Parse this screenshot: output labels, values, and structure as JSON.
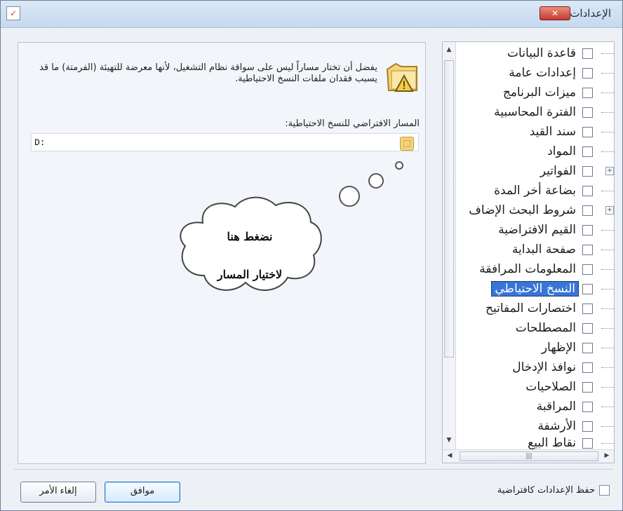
{
  "window": {
    "title": "الإعدادات",
    "title_icon": "settings-checklist-icon",
    "close_label": "✕"
  },
  "warning": {
    "icon": "warning-folder-icon",
    "text": "يفضل أن تختار مساراً ليس على سواقة نظام التشغيل، لأنها معرضة للتهيئة (الفرمتة) ما قد يسبب فقدان ملفات النسخ الاحتياطية."
  },
  "backup_path": {
    "label": "المسار الافتراضي للنسخ الاحتياطية:",
    "value": "D:",
    "browse_icon": "browse-folder-icon"
  },
  "callout": {
    "line1": "نضغط هنا",
    "line2": "لاختيار المسار"
  },
  "tree": {
    "items": [
      {
        "label": "قاعدة البيانات",
        "icon": "database-icon",
        "color": "#9b6fcf",
        "expandable": false
      },
      {
        "label": "إعدادات عامة",
        "icon": "checklist-icon",
        "color": "#d74b4b",
        "expandable": false
      },
      {
        "label": "ميزات البرنامج",
        "icon": "puzzle-icon",
        "color": "#3f9a3a",
        "expandable": false
      },
      {
        "label": "الفترة المحاسبية",
        "icon": "calendar-icon",
        "color": "#e15f42",
        "expandable": false
      },
      {
        "label": "سند القيد",
        "icon": "document-icon",
        "color": "#5b7db1",
        "expandable": false
      },
      {
        "label": "المواد",
        "icon": "box-icon",
        "color": "#d39b1f",
        "expandable": false
      },
      {
        "label": "الفواتير",
        "icon": "notepad-icon",
        "color": "#e8c84e",
        "expandable": true
      },
      {
        "label": "بضاعة أخر المدة",
        "icon": "box-icon",
        "color": "#d39b1f",
        "expandable": false
      },
      {
        "label": "شروط البحث الإضاف",
        "icon": "magnifier-icon",
        "color": "#4f7dc4",
        "expandable": true
      },
      {
        "label": "القيم الافتراضية",
        "icon": "check-circle-icon",
        "color": "#2f9d37",
        "expandable": false
      },
      {
        "label": "صفحة البداية",
        "icon": "brush-icon",
        "color": "#e0a429",
        "expandable": false
      },
      {
        "label": "المعلومات المرافقة",
        "icon": "info-icon",
        "color": "#3b7bd4",
        "expandable": false
      },
      {
        "label": "النسخ الاحتياطي",
        "icon": "backup-icon",
        "color": "#4d79b9",
        "expandable": false,
        "selected": true
      },
      {
        "label": "اختصارات المفاتيح",
        "icon": "keyboard-icon",
        "color": "#7f8c9a",
        "expandable": false
      },
      {
        "label": "المصطلحات",
        "icon": "terms-icon",
        "color": "#d44f4f",
        "expandable": false
      },
      {
        "label": "الإظهار",
        "icon": "display-icon",
        "color": "#3b68b8",
        "expandable": false
      },
      {
        "label": "نوافذ الإدخال",
        "icon": "edit-window-icon",
        "color": "#4aa0d6",
        "expandable": false
      },
      {
        "label": "الصلاحيات",
        "icon": "lock-icon",
        "color": "#e0ad1d",
        "expandable": false
      },
      {
        "label": "المراقبة",
        "icon": "monitor-icon",
        "color": "#4b6fa5",
        "expandable": false
      },
      {
        "label": "الأرشفة",
        "icon": "paperclip-icon",
        "color": "#6b86b1",
        "expandable": false
      },
      {
        "label": "نقاط البيع",
        "icon": "pos-icon",
        "color": "#6d7ea0",
        "expandable": false
      }
    ]
  },
  "footer": {
    "save_default_label": "حفظ الإعدادات كافتراضية",
    "ok_label": "موافق",
    "cancel_label": "إلغاء الأمر"
  }
}
